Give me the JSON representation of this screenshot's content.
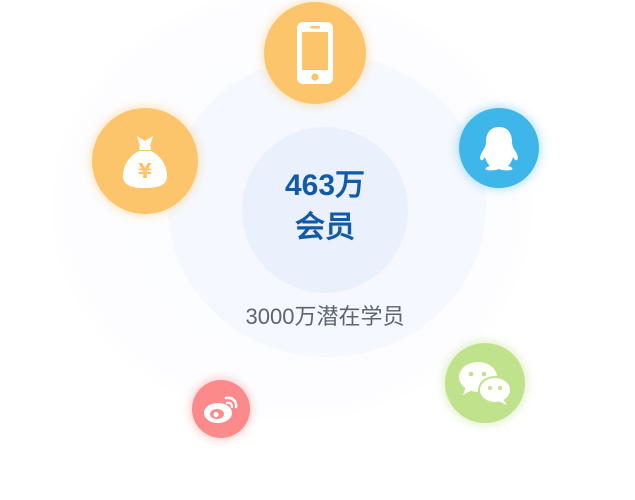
{
  "members": {
    "count": "463万",
    "label": "会员"
  },
  "potential": {
    "text": "3000万潜在学员"
  },
  "channels": [
    {
      "icon": "mobile-phone-icon",
      "color": "#fdc56b"
    },
    {
      "icon": "money-bag-icon",
      "color": "#fdc56b",
      "symbol": "¥"
    },
    {
      "icon": "qq-penguin-icon",
      "color": "#3fb6ea"
    },
    {
      "icon": "wechat-icon",
      "color": "#c0e28d"
    },
    {
      "icon": "weibo-icon",
      "color": "#fd8a8a"
    }
  ]
}
